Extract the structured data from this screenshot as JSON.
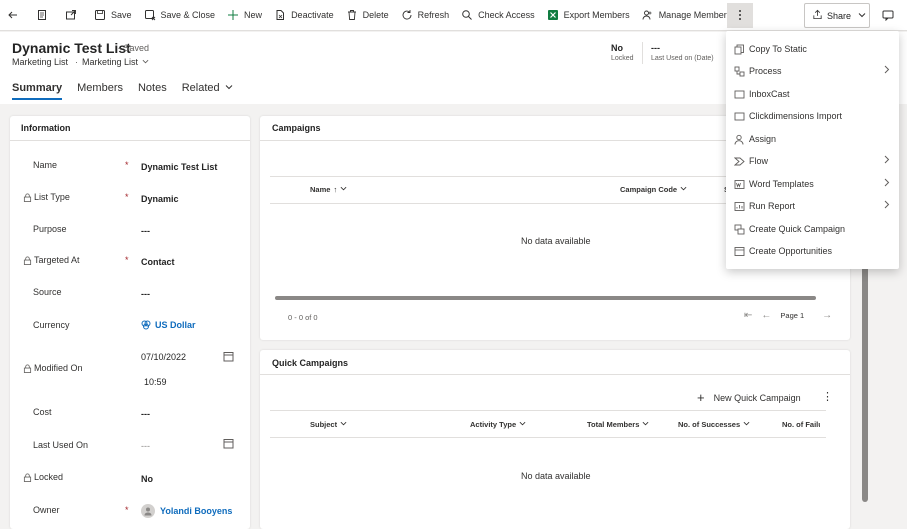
{
  "toolbar": {
    "save": "Save",
    "save_close": "Save & Close",
    "new": "New",
    "deactivate": "Deactivate",
    "delete": "Delete",
    "refresh": "Refresh",
    "check_access": "Check Access",
    "export_members": "Export Members",
    "manage_members": "Manage Members",
    "share": "Share"
  },
  "header": {
    "title": "Dynamic Test List",
    "saved_status": "- Saved",
    "entity": "Marketing List",
    "separator": "·",
    "form_name": "Marketing List",
    "fields": [
      {
        "value": "No",
        "label": "Locked"
      },
      {
        "value": "---",
        "label": "Last Used on (Date)"
      }
    ]
  },
  "tabs": [
    "Summary",
    "Members",
    "Notes",
    "Related"
  ],
  "information": {
    "title": "Information",
    "fields": [
      {
        "label": "Name",
        "value": "Dynamic Test List"
      },
      {
        "label": "List Type",
        "value": "Dynamic"
      },
      {
        "label": "Purpose",
        "value": "---"
      },
      {
        "label": "Targeted At",
        "value": "Contact"
      },
      {
        "label": "Source",
        "value": "---"
      },
      {
        "label": "Currency",
        "value": "US Dollar"
      },
      {
        "label": "Modified On",
        "date": "07/10/2022",
        "time": "10:59"
      },
      {
        "label": "Cost",
        "value": "---"
      },
      {
        "label": "Last Used On",
        "value": "---"
      },
      {
        "label": "Locked",
        "value": "No"
      },
      {
        "label": "Owner",
        "value": "Yolandi Booyens"
      }
    ],
    "required_mark": "*"
  },
  "campaigns": {
    "title": "Campaigns",
    "columns": [
      "Name",
      "Campaign Code",
      "S"
    ],
    "sort_arrow": "↑",
    "empty": "No data available",
    "count": "0 - 0 of 0",
    "page": "Page 1"
  },
  "quick_campaigns": {
    "title": "Quick Campaigns",
    "new_button": "New Quick Campaign",
    "columns": [
      "Subject",
      "Activity Type",
      "Total Members",
      "No. of Successes",
      "No. of Failu"
    ],
    "empty": "No data available"
  },
  "overflow_menu": {
    "items": [
      {
        "label": "Copy To Static",
        "icon": "copy-icon",
        "submenu": false
      },
      {
        "label": "Process",
        "icon": "process-icon",
        "submenu": true
      },
      {
        "label": "InboxCast",
        "icon": "inbox-icon",
        "submenu": false
      },
      {
        "label": "Clickdimensions Import",
        "icon": "import-icon",
        "submenu": false
      },
      {
        "label": "Assign",
        "icon": "person-icon",
        "submenu": false
      },
      {
        "label": "Flow",
        "icon": "flow-icon",
        "submenu": true
      },
      {
        "label": "Word Templates",
        "icon": "word-icon",
        "submenu": true
      },
      {
        "label": "Run Report",
        "icon": "report-icon",
        "submenu": true
      },
      {
        "label": "Create Quick Campaign",
        "icon": "campaign-icon",
        "submenu": false
      },
      {
        "label": "Create Opportunities",
        "icon": "opportunity-icon",
        "submenu": false
      }
    ]
  },
  "colors": {
    "accent": "#0f6cbd",
    "required": "#a4262c",
    "excel_green": "#107c41"
  }
}
